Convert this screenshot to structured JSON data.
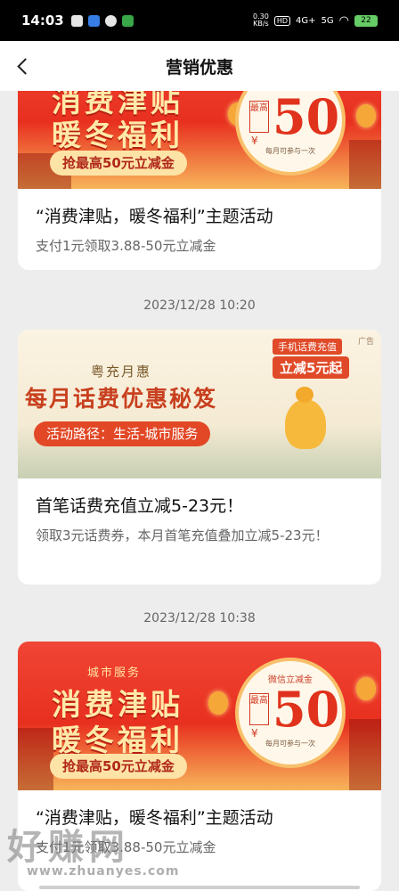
{
  "status_bar": {
    "time": "14:03",
    "net_rate_top": "0.30",
    "net_rate_bottom": "KB/s",
    "hd": "HD",
    "g4": "4G+",
    "g5": "5G",
    "battery": "22"
  },
  "nav": {
    "title": "营销优惠"
  },
  "cards": [
    {
      "banner": {
        "line1": "消费津贴",
        "line2": "暖冬福利",
        "pill": "抢最高50元立减金",
        "max_label": "最高",
        "yen": "¥",
        "amount": "50",
        "note": "每月可参与一次"
      },
      "title": "“消费津贴，暖冬福利”主题活动",
      "desc": "支付1元领取3.88-50元立减金"
    },
    {
      "timestamp": "2023/12/28 10:20",
      "banner": {
        "sub": "粤充月惠",
        "main": "每月话费优惠秘笈",
        "path": "活动路径：生活-城市服务",
        "ad": "广告",
        "promo1": "手机话费充值",
        "promo2": "立减5元起"
      },
      "title": "首笔话费充值立减5-23元！",
      "desc": "领取3元话费券，本月首笔充值叠加立减5-23元！"
    },
    {
      "timestamp": "2023/12/28 10:38",
      "banner": {
        "city": "城市服务",
        "line1": "消费津贴",
        "line2": "暖冬福利",
        "pill": "抢最高50元立减金",
        "top_tag": "微信立减金",
        "max_label": "最高",
        "yen": "¥",
        "amount": "50",
        "note": "每月可参与一次"
      },
      "title": "“消费津贴，暖冬福利”主题活动",
      "desc": "支付1元领取3.88-50元立减金"
    }
  ],
  "watermark": {
    "cn": "好赚网",
    "url": "www.zhuanyes.com"
  }
}
